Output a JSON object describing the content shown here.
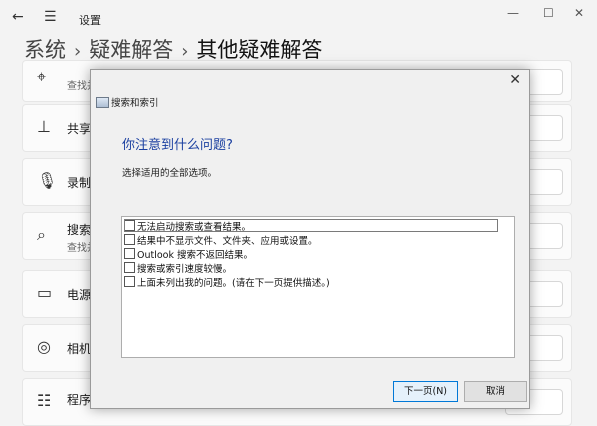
{
  "window": {
    "title": "设置",
    "back_icon": "←",
    "menu_icon": "☰",
    "minimize_icon": "—",
    "maximize_icon": "☐",
    "close_icon": "✕"
  },
  "breadcrumb": {
    "items": [
      "系统",
      "疑难解答",
      "其他疑难解答"
    ],
    "separator": "›"
  },
  "rows": [
    {
      "icon": "⌖",
      "label": "",
      "sub": "查找并"
    },
    {
      "icon": "⊥",
      "label": "共享",
      "sub": ""
    },
    {
      "icon": "🎙",
      "label": "录制",
      "sub": ""
    },
    {
      "icon": "⌕",
      "label": "搜索",
      "sub": "查找并"
    },
    {
      "icon": "▭",
      "label": "电源",
      "sub": ""
    },
    {
      "icon": "◎",
      "label": "相机",
      "sub": ""
    },
    {
      "icon": "☷",
      "label": "程序",
      "sub": ""
    }
  ],
  "dialog": {
    "title": "搜索和索引",
    "close_icon": "✕",
    "heading": "你注意到什么问题?",
    "instruction": "选择适用的全部选项。",
    "options": [
      "无法启动搜索或查看结果。",
      "结果中不显示文件、文件夹、应用或设置。",
      "Outlook 搜索不返回结果。",
      "搜索或索引速度较慢。",
      "上面未列出我的问题。(请在下一页提供描述。)"
    ],
    "next_label": "下一页(N)",
    "cancel_label": "取消"
  }
}
